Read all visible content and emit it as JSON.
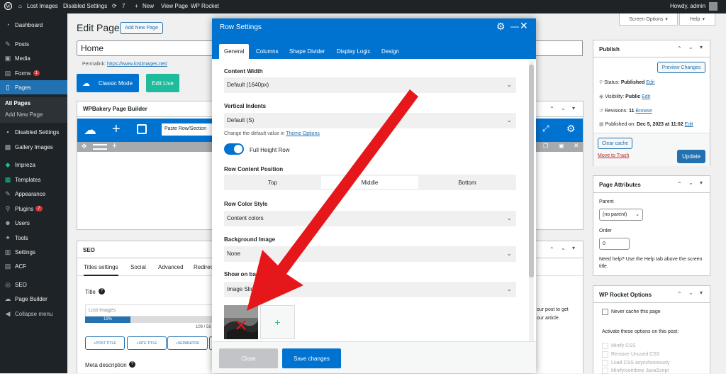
{
  "adminbar": {
    "site": "Lost Images",
    "disabled": "Disabled Settings",
    "updates": "7",
    "new": "New",
    "view": "View Page",
    "rocket": "WP Rocket",
    "howdy": "Howdy, admin"
  },
  "sidebar": {
    "items": [
      "Dashboard",
      "Posts",
      "Media",
      "Forms",
      "Pages",
      "Disabled Settings",
      "Gallery Images",
      "Impreza",
      "Templates",
      "Appearance",
      "Plugins",
      "Users",
      "Tools",
      "Settings",
      "ACF",
      "SEO",
      "Page Builder",
      "Collapse menu"
    ],
    "forms_badge": "1",
    "plugins_badge": "7",
    "sub": [
      "All Pages",
      "Add New Page"
    ]
  },
  "header": {
    "title": "Edit Page",
    "add_new": "Add New Page",
    "screen_options": "Screen Options",
    "help": "Help",
    "page_title_value": "Home",
    "permalink_label": "Permalink:",
    "permalink_url": "https://www.lostimages.net/",
    "classic_mode": "Classic Mode",
    "edit_live": "Edit Live"
  },
  "wpbakery": {
    "title": "WPBakery Page Builder",
    "paste": "Paste Row/Section"
  },
  "seo": {
    "title": "SEO",
    "tabs": [
      "Titles settings",
      "Social",
      "Advanced",
      "Redirec"
    ],
    "title_label": "Title",
    "title_placeholder": "Lost Images",
    "progress": "19%",
    "counter": "109 / 56",
    "buttons": [
      "POST TITLE",
      "SITE TITLE",
      "SEPARATOR"
    ],
    "meta_label": "Meta description",
    "side_text_1": "our post to get",
    "side_text_2": "our article."
  },
  "modal": {
    "title": "Row Settings",
    "tabs": [
      "General",
      "Columns",
      "Shape Divider",
      "Display Logic",
      "Design"
    ],
    "content_width_label": "Content Width",
    "content_width_value": "Default (1640px)",
    "vertical_indents_label": "Vertical Indents",
    "vertical_indents_value": "Default (S)",
    "change_default": "Change the default value in",
    "theme_options": "Theme Options",
    "full_height": "Full Height Row",
    "position_label": "Row Content Position",
    "positions": [
      "Top",
      "Middle",
      "Bottom"
    ],
    "color_style_label": "Row Color Style",
    "color_style_value": "Content colors",
    "bg_image_label": "Background Image",
    "bg_image_value": "None",
    "show_on_bg_label": "Show on backgr",
    "show_on_bg_value": "Image Slide",
    "add_symbol": "+",
    "close": "Close",
    "save": "Save changes"
  },
  "publish": {
    "title": "Publish",
    "preview": "Preview Changes",
    "status_label": "Status:",
    "status_value": "Published",
    "visibility_label": "Visibility:",
    "visibility_value": "Public",
    "revisions_label": "Revisions:",
    "revisions_value": "11",
    "browse": "Browse",
    "published_on": "Published on:",
    "published_date": "Dec 5, 2023 at 11:02",
    "edit": "Edit",
    "clear_cache": "Clear cache",
    "trash": "Move to Trash",
    "update": "Update"
  },
  "attributes": {
    "title": "Page Attributes",
    "parent_label": "Parent",
    "parent_value": "(no parent)",
    "order_label": "Order",
    "order_value": "0",
    "help": "Need help? Use the Help tab above the screen title."
  },
  "rocket": {
    "title": "WP Rocket Options",
    "never_cache": "Never cache this page",
    "activate": "Activate these options on this post:",
    "options": [
      "Minify CSS",
      "Remove Unused CSS",
      "Load CSS asynchronously",
      "Minify/combine JavaScript"
    ]
  },
  "colors": {
    "wp_blue": "#2271b1",
    "builder_blue": "#0073d1",
    "arrow": "#e5171a",
    "teal": "#1ebc9c"
  }
}
